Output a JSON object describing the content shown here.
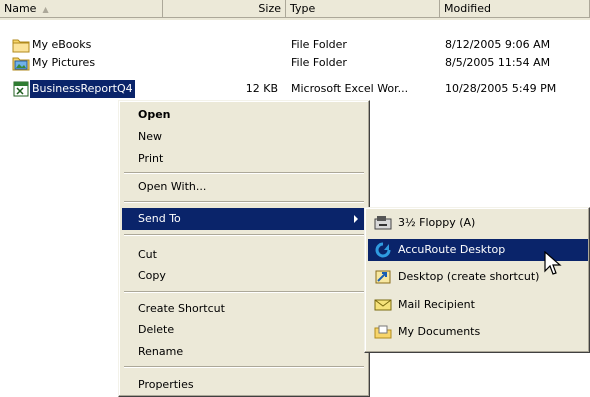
{
  "header": {
    "name": "Name",
    "size": "Size",
    "type": "Type",
    "modified": "Modified"
  },
  "files": [
    {
      "name": "My eBooks",
      "size": "",
      "type": "File Folder",
      "modified": "8/12/2005 9:06 AM",
      "icon": "folder-icon"
    },
    {
      "name": "My Pictures",
      "size": "",
      "type": "File Folder",
      "modified": "8/5/2005 11:54 AM",
      "icon": "pictures-folder-icon"
    },
    {
      "name": "BusinessReportQ4",
      "size": "12 KB",
      "type": "Microsoft Excel Wor...",
      "modified": "10/28/2005 5:49 PM",
      "icon": "excel-file-icon"
    }
  ],
  "context_menu": {
    "open": "Open",
    "new": "New",
    "print": "Print",
    "open_with": "Open With...",
    "send_to": "Send To",
    "cut": "Cut",
    "copy": "Copy",
    "create_shortcut": "Create Shortcut",
    "delete": "Delete",
    "rename": "Rename",
    "properties": "Properties"
  },
  "send_to_menu": {
    "floppy": "3½ Floppy (A)",
    "accuroute": "AccuRoute Desktop",
    "desktop": "Desktop (create shortcut)",
    "mail": "Mail Recipient",
    "documents": "My Documents"
  },
  "colors": {
    "highlight": "#0a246a",
    "menu_bg": "#ece9d8"
  }
}
